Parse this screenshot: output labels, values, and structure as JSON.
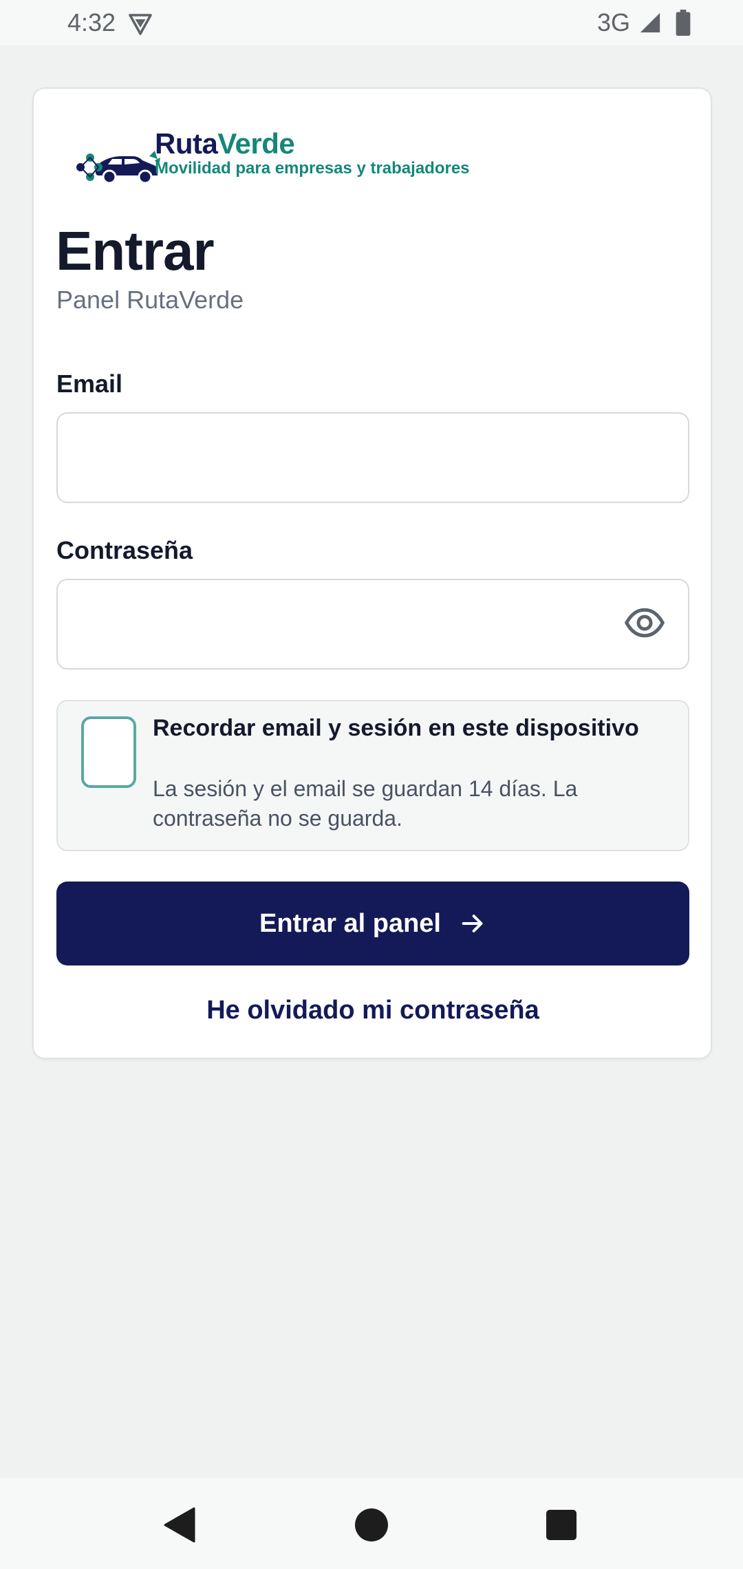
{
  "status_bar": {
    "time": "4:32",
    "network": "3G",
    "vpn_icon": "vpn-shield-icon",
    "signal_icon": "cell-signal-icon",
    "battery_icon": "battery-icon"
  },
  "brand": {
    "name_part1": "Ruta",
    "name_part2": "Verde",
    "tagline": "Movilidad para empresas y trabajadores",
    "logo_icon": "car-route-logo-icon"
  },
  "login": {
    "title": "Entrar",
    "subtitle": "Panel RutaVerde",
    "email_label": "Email",
    "email_value": "",
    "password_label": "Contraseña",
    "password_value": "",
    "show_password_icon": "eye-icon",
    "remember_title": "Recordar email y sesión en este dispositivo",
    "remember_description": "La sesión y el email se guardan 14 días. La contraseña no se guarda.",
    "remember_checked": false,
    "submit_label": "Entrar al panel",
    "submit_icon": "arrow-right-icon",
    "forgot_link": "He olvidado mi contraseña"
  },
  "colors": {
    "navy": "#141a57",
    "teal": "#14877a",
    "background": "#eff2f1",
    "checkbox_border": "#5aa8a3"
  }
}
